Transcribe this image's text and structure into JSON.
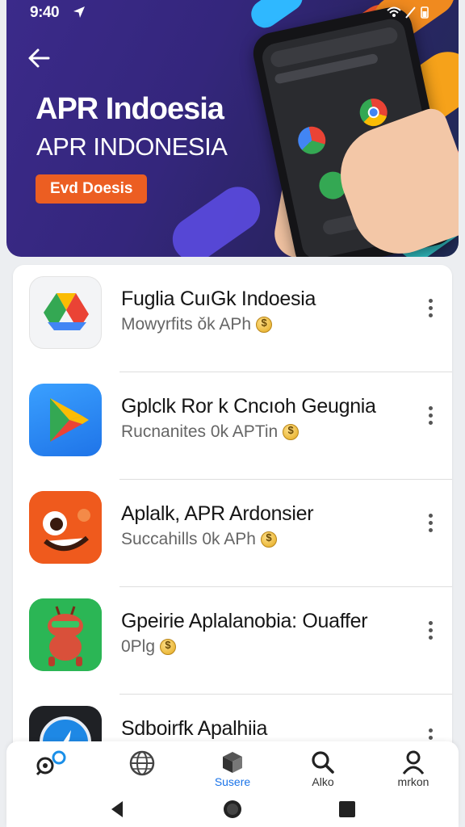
{
  "status": {
    "time": "9:40"
  },
  "hero": {
    "title": "APR Indoesia",
    "subtitle": "APR INDONESIA",
    "button_label": "Evd Doesis"
  },
  "apps": [
    {
      "title": "Fuglia CuıGk Indoesia",
      "meta": "Mowyrfits ǒk APh",
      "icon": "drive-triangle-icon"
    },
    {
      "title": "Gplclk Ror k Cncıoh Geugnia",
      "meta": "Rucnanites 0k APTin",
      "icon": "play-triangle-icon"
    },
    {
      "title": "Aplalk, APR Ardonsier",
      "meta": "Succahills 0k APh",
      "icon": "orange-monster-icon"
    },
    {
      "title": "Gpeirie Aplalanobia: Ouaffer",
      "meta": "0Plg",
      "icon": "red-robot-icon"
    },
    {
      "title": "Sdboirfk Apalhiia",
      "meta": "",
      "icon": "compass-icon"
    }
  ],
  "nav": [
    {
      "label": "",
      "icon": "discover-icon",
      "active": false
    },
    {
      "label": "",
      "icon": "globe-icon",
      "active": false
    },
    {
      "label": "Susere",
      "icon": "store-box-icon",
      "active": true
    },
    {
      "label": "Alko",
      "icon": "search-icon",
      "active": false
    },
    {
      "label": "mrkon",
      "icon": "person-icon",
      "active": false
    }
  ],
  "colors": {
    "accent": "#1a73e8",
    "hero_button": "#ec5e22",
    "hero_bg": "#34267c"
  }
}
